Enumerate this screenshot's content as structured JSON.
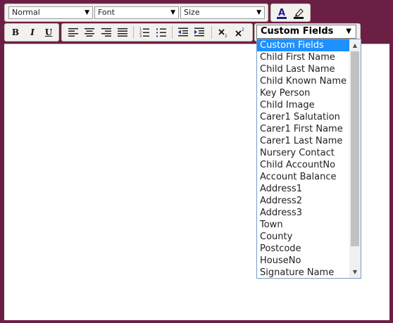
{
  "toolbar_row1": {
    "paragraph_format": "Normal",
    "font": "Font",
    "size": "Size"
  },
  "custom_fields": {
    "selected": "Custom Fields",
    "options": [
      "Custom Fields",
      "Child First Name",
      "Child Last Name",
      "Child Known Name",
      "Key Person",
      "Child Image",
      "Carer1 Salutation",
      "Carer1 First Name",
      "Carer1 Last Name",
      "Nursery Contact",
      "Child AccountNo",
      "Account Balance",
      "Address1",
      "Address2",
      "Address3",
      "Town",
      "County",
      "Postcode",
      "HouseNo",
      "Signature Name"
    ]
  },
  "format_buttons": {
    "bold": "B",
    "italic": "I",
    "underline": "U"
  },
  "colors": {
    "frame": "#6b1f45",
    "selection": "#1e90ff"
  }
}
